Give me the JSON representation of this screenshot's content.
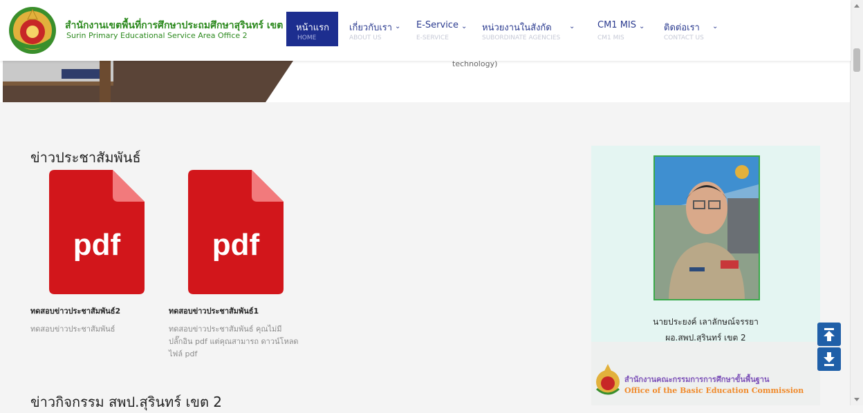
{
  "header": {
    "brand_th": "สำนักงานเขตพื้นที่การศึกษาประถมศึกษาสุรินทร์ เขต 2",
    "brand_en": "Surin Primary Educational Service Area Office 2",
    "nav": [
      {
        "label": "หน้าแรก",
        "sub": "HOME",
        "active": true
      },
      {
        "label": "เกี่ยวกับเรา",
        "sub": "ABOUT US"
      },
      {
        "label": "E-Service",
        "sub": "E-SERVICE"
      },
      {
        "label": "หน่วยงานในสังกัด",
        "sub": "SUBORDINATE AGENCIES"
      },
      {
        "label": "CM1 MIS",
        "sub": "CM1 MIS"
      },
      {
        "label": "ติดต่อเรา",
        "sub": "CONTACT US"
      }
    ]
  },
  "hero": {
    "text": "technology)"
  },
  "news": {
    "title": "ข่าวประชาสัมพันธ์",
    "items": [
      {
        "icon_text": "pdf",
        "title": "ทดสอบข่าวประชาสัมพันธ์2",
        "desc": "ทดสอบข่าวประชาสัมพันธ์"
      },
      {
        "icon_text": "pdf",
        "title": "ทดสอบข่าวประชาสัมพันธ์1",
        "desc": "ทดสอบข่าวประชาสัมพันธ์ คุณไม่มีปลั๊กอิน pdf แต่คุณสามารถ ดาวน์โหลดไฟล์ pdf"
      }
    ],
    "next_section_title": "ข่าวกิจกรรม สพป.สุรินทร์ เขต 2"
  },
  "director": {
    "name": "นายประยงค์ เลาลักษณ์จรรยา",
    "position": "ผอ.สพป.สุรินทร์ เขต 2"
  },
  "obec": {
    "name_th": "สำนักงานคณะกรรมการการศึกษาขั้นพื้นฐาน",
    "name_en": "Office of the Basic Education Commission"
  },
  "colors": {
    "nav_active": "#1d2e8f",
    "brand": "#2d8a1f",
    "pdf_red": "#d2161b",
    "scroll_button": "#1f5fa8"
  },
  "icons": {
    "scroll_up": "arrow-up-icon",
    "scroll_down": "arrow-down-icon"
  }
}
